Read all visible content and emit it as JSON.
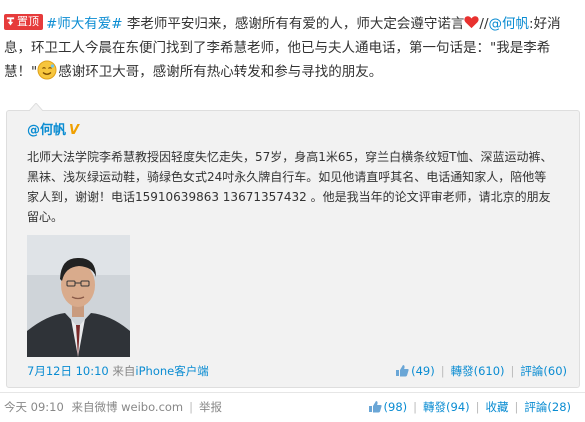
{
  "post": {
    "pin_label": "置顶",
    "topic": "#师大有爱#",
    "line1": "李老师平安归来，感谢所有有爱的人，师大定会遵守诺言",
    "repost_slashes": "//",
    "mention": "@何帆",
    "line2_rest": ":好消息，环卫工人今晨在东便门找到了李希慧老师，他已与夫人通电话，第一句话是：\"我是李希慧！\"",
    "thanks": "感谢环卫大哥，感谢所有热心转发和参与寻找的朋友。"
  },
  "original": {
    "author": "@何帆",
    "verified_mark": "V",
    "text": "北师大法学院李希慧教授因轻度失忆走失，57岁，身高1米65，穿兰白横条纹短T恤、深蓝运动裤、黑袜、浅灰绿运动鞋，骑绿色女式24吋永久牌自行车。如见他请直呼其名、电话通知家人，陪他等家人到，谢谢！电话15910639863 13671357432 。他是我当年的论文评审老师，请北京的朋友留心。",
    "time": "7月12日 10:10",
    "source_prefix": "来自",
    "source": "iPhone客户端",
    "likes": "(49)",
    "repost_label": "轉發(610)",
    "comment_label": "評論(60)"
  },
  "meta": {
    "time": "今天 09:10",
    "source_prefix": "来自",
    "source": "微博 weibo.com",
    "manage": "举报"
  },
  "actions": {
    "likes": "(98)",
    "repost_label": "轉發(94)",
    "favorite_label": "收藏",
    "comment_label": "評論(28)"
  },
  "colors": {
    "link": "#0a8cd2",
    "pin": "#e63b3b",
    "heart": "#e8312f",
    "box_bg": "#f2f2f2"
  },
  "icons": {
    "pin": "pin-icon",
    "heart": "heart-icon",
    "smiley": "smiley-icon",
    "like": "thumbs-up-icon"
  }
}
